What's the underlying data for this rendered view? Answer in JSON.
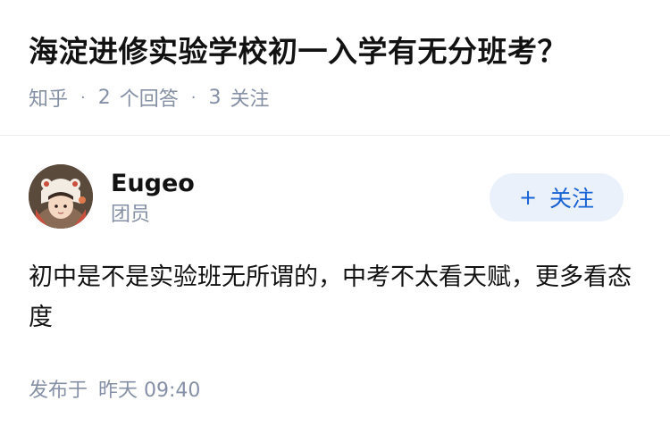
{
  "question": {
    "title": "海淀进修实验学校初一入学有无分班考？",
    "source": "知乎",
    "answers_count": "2",
    "answers_label": "个回答",
    "followers_count": "3",
    "followers_label": "关注"
  },
  "answer": {
    "author": {
      "name": "Eugeo",
      "badge": "团员",
      "avatar_icon": "user-avatar"
    },
    "follow_button": {
      "icon": "+",
      "label": "关注"
    },
    "content": "初中是不是实验班无所谓的，中考不太看天赋，更多看态度",
    "published_label": "发布于",
    "published_time": "昨天 09:40"
  },
  "colors": {
    "text_primary": "#121212",
    "text_secondary": "#8590a6",
    "accent": "#1763d6",
    "button_bg": "#ebf1fb",
    "divider": "#ebebeb"
  }
}
